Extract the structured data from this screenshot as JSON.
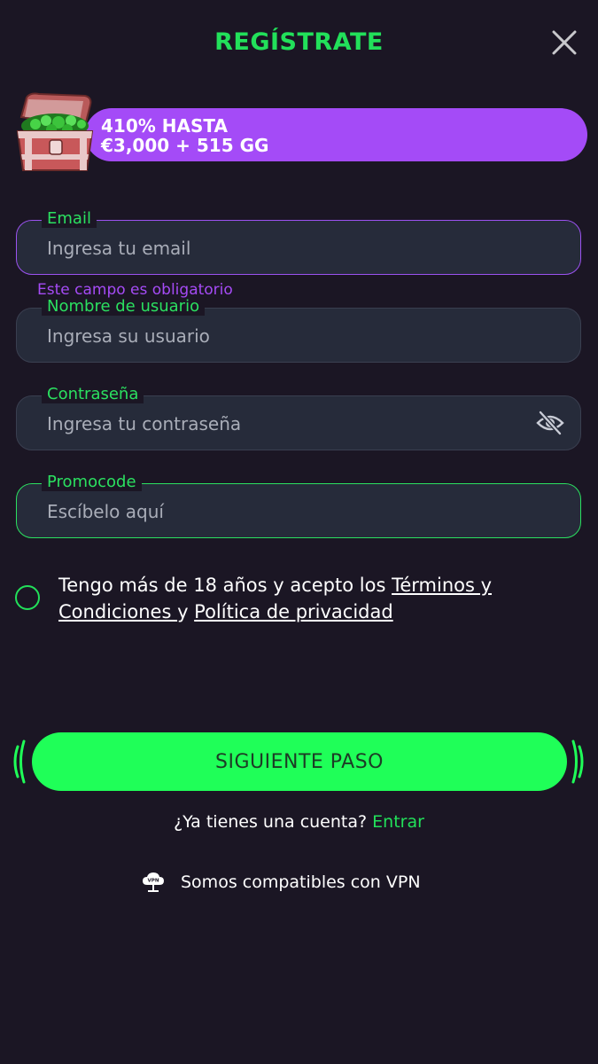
{
  "header": {
    "title": "REGÍSTRATE"
  },
  "promo": {
    "line1": "410% HASTA",
    "line2": "€3,000 + 515 GG",
    "banner_color": "#a44bf7"
  },
  "form": {
    "email": {
      "label": "Email",
      "placeholder": "Ingresa tu email",
      "value": "",
      "error": "Este campo es obligatorio"
    },
    "username": {
      "label": "Nombre de usuario",
      "placeholder": "Ingresa su usuario",
      "value": ""
    },
    "password": {
      "label": "Contraseña",
      "placeholder": "Ingresa tu contraseña",
      "value": ""
    },
    "promocode": {
      "label": "Promocode",
      "placeholder": "Escíbelo aquí",
      "value": ""
    }
  },
  "terms": {
    "text_before": "Tengo más de 18 años y acepto los ",
    "link_terms": "Términos y Condiciones ",
    "connector": "y ",
    "link_privacy": "Política de privacidad",
    "checked": false
  },
  "cta": {
    "label": "SIGUIENTE PASO"
  },
  "login": {
    "question": "¿Ya tienes una cuenta? ",
    "link": "Entrar"
  },
  "vpn": {
    "icon_text": "VPN",
    "text": "Somos compatibles con VPN"
  },
  "icons": {
    "close": "close-icon",
    "eye": "eye-slash-icon",
    "chest": "treasure-chest-icon",
    "vpn": "vpn-cloud-icon"
  },
  "colors": {
    "background": "#1b1624",
    "accent_green": "#22e05a",
    "cta_green": "#1fff58",
    "purple": "#a44bf7"
  }
}
